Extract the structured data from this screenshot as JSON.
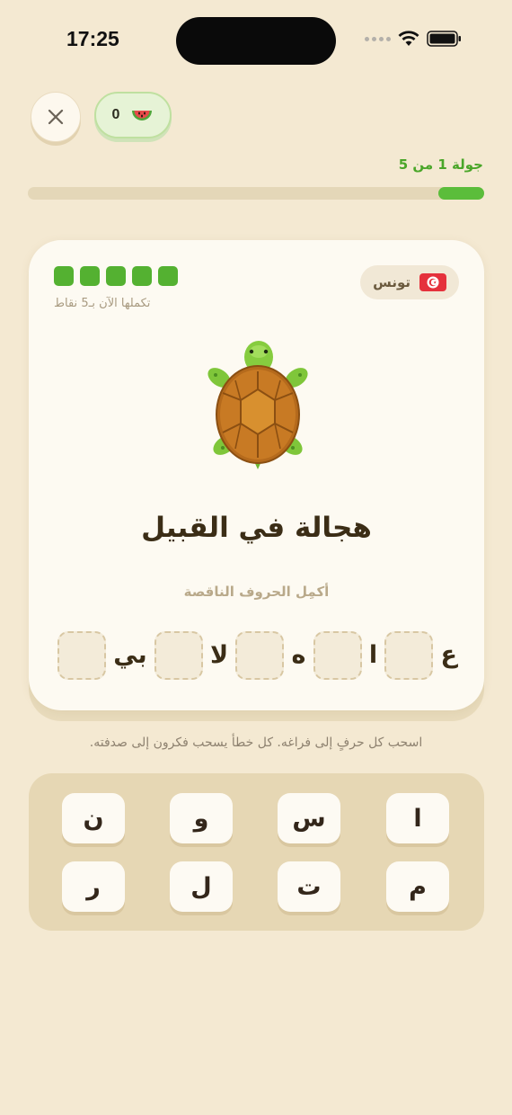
{
  "status_bar": {
    "time": "17:25"
  },
  "header": {
    "seed_count": "0",
    "round_label": "جولة 1 من 5",
    "progress_fraction": 0.1
  },
  "card": {
    "country": "تونس",
    "points_text": "تكملها الآن بـ5 نقاط",
    "points_boxes": 5,
    "word": "هجالة في القبيل",
    "instruction": "أكمِل الحروف الناقصة",
    "letters": [
      "ع",
      "ا",
      "ه",
      "لا",
      "بي"
    ]
  },
  "hint": "اسحب كل حرفٍ إلى فراغه. كل خطأ يسحب فكرون إلى صدفته.",
  "keys": [
    "ا",
    "س",
    "و",
    "ن",
    "م",
    "ت",
    "ل",
    "ر"
  ],
  "colors": {
    "accent_green": "#5bbd3b",
    "background": "#f4e9d2",
    "card": "#fdfaf2"
  }
}
